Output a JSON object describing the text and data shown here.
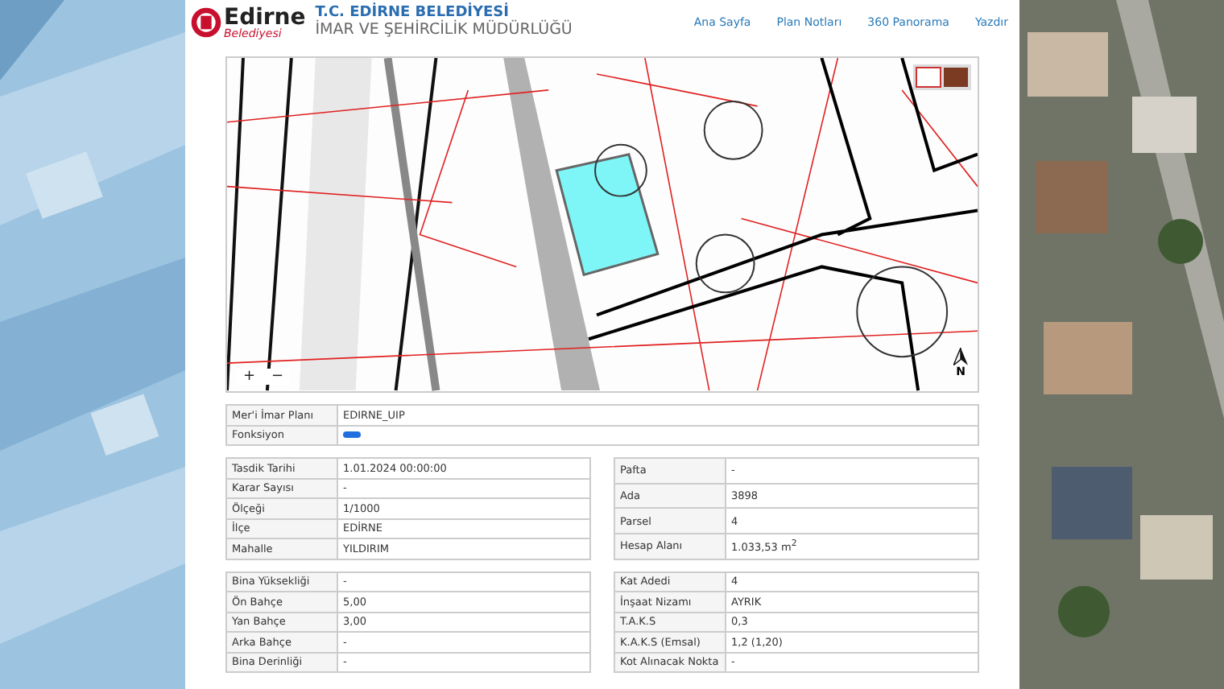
{
  "header": {
    "logo_word": "Edirne",
    "logo_sub": "Belediyesi",
    "title": "T.C. EDİRNE BELEDİYESİ",
    "subtitle": "İMAR VE ŞEHİRCİLİK MÜDÜRLÜĞÜ",
    "nav": [
      "Ana Sayfa",
      "Plan Notları",
      "360 Panorama",
      "Yazdır"
    ]
  },
  "map": {
    "zoom_in": "+",
    "zoom_out": "−",
    "north": "N"
  },
  "plan_table": [
    {
      "label": "Mer'i İmar Planı",
      "value": "EDIRNE_UIP"
    },
    {
      "label": "Fonksiyon",
      "color": "#1f6fe0"
    }
  ],
  "sections": [
    {
      "left": [
        {
          "label": "Tasdik Tarihi",
          "value": "1.01.2024 00:00:00"
        },
        {
          "label": "Karar Sayısı",
          "value": "-"
        },
        {
          "label": "Ölçeği",
          "value": "1/1000"
        },
        {
          "label": "İlçe",
          "value": "EDİRNE"
        },
        {
          "label": "Mahalle",
          "value": "YILDIRIM"
        }
      ],
      "right": [
        {
          "label": "Pafta",
          "value": "-"
        },
        {
          "label": "Ada",
          "value": "3898"
        },
        {
          "label": "Parsel",
          "value": "4"
        },
        {
          "label": "Hesap Alanı",
          "value": "1.033,53 m$^{2}$"
        }
      ]
    },
    {
      "left": [
        {
          "label": "Bina Yüksekliği",
          "value": "-"
        },
        {
          "label": "Ön Bahçe",
          "value": "5,00"
        },
        {
          "label": "Yan Bahçe",
          "value": "3,00"
        },
        {
          "label": "Arka Bahçe",
          "value": "-"
        },
        {
          "label": "Bina Derinliği",
          "value": "-"
        }
      ],
      "right": [
        {
          "label": "Kat Adedi",
          "value": "4"
        },
        {
          "label": "İnşaat Nizamı",
          "value": "AYRIK"
        },
        {
          "label": "T.A.K.S",
          "value": "0,3"
        },
        {
          "label": "K.A.K.S (Emsal)",
          "value": "1,2 (1,20)"
        },
        {
          "label": "Kot Alınacak Nokta",
          "value": "-"
        }
      ]
    }
  ]
}
